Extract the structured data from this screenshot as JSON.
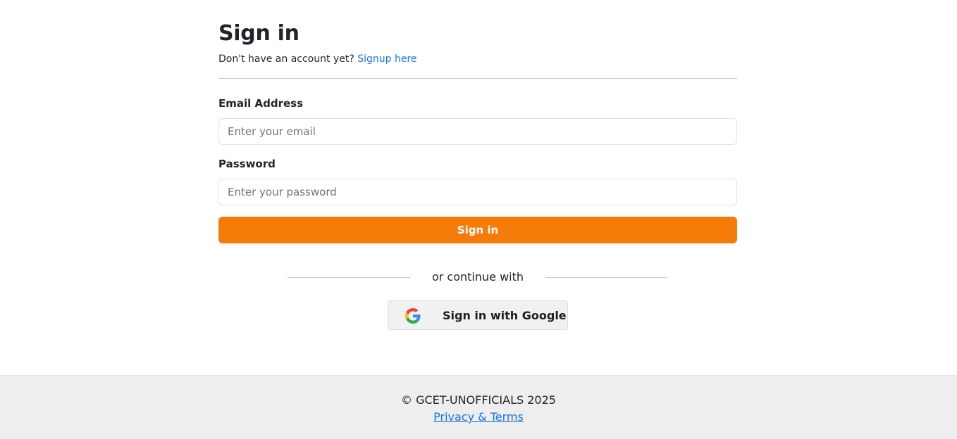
{
  "header": {
    "title": "Sign in",
    "prompt": "Don't have an account yet? ",
    "signup_link": "Signup here"
  },
  "form": {
    "email_label": "Email Address",
    "email_placeholder": "Enter your email",
    "email_value": "",
    "password_label": "Password",
    "password_placeholder": "Enter your password",
    "password_value": "",
    "submit_label": "Sign in",
    "accent_color": "#f57c09"
  },
  "alt_login": {
    "divider_text": "or continue with",
    "google_label": "Sign in with Google",
    "google_icon": "google-g-logo"
  },
  "footer": {
    "copyright": "© GCET-UNOFFICIALS 2025",
    "privacy_link": "Privacy & Terms"
  }
}
